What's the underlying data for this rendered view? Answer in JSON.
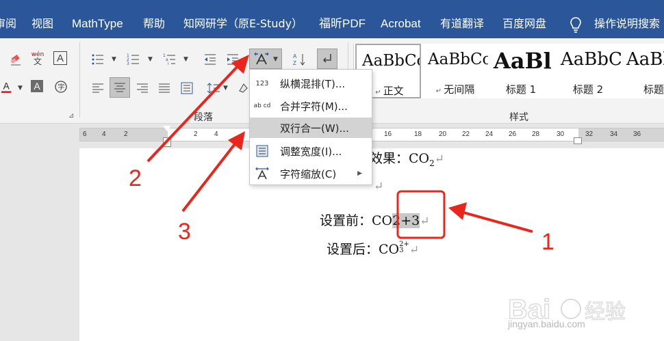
{
  "tabs": [
    "审阅",
    "视图",
    "MathType",
    "帮助",
    "知网研学（原E-Study）",
    "福昕PDF",
    "Acrobat",
    "有道翻译",
    "百度网盘",
    "操作说明搜索"
  ],
  "colors": {
    "tabbar": "#2b579a",
    "annotation_red": "#e8261c",
    "highlight_gray": "#c8c8c8",
    "menu_hover": "#d3d3d3"
  },
  "ribbon": {
    "group_paragraph_label": "段落",
    "group_styles_label": "样式",
    "icons": [
      "clear-format-icon",
      "phonetic-guide-icon",
      "character-border-icon",
      "font-color-icon",
      "character-shading-icon",
      "enclose-characters-icon",
      "bullets-icon",
      "numbering-icon",
      "multilevel-list-icon",
      "decrease-indent-icon",
      "increase-indent-icon",
      "asian-layout-icon",
      "sort-icon",
      "show-marks-icon",
      "align-left-icon",
      "align-center-icon",
      "align-right-icon",
      "justify-icon",
      "distributed-icon",
      "line-spacing-icon",
      "shading-icon",
      "borders-icon"
    ],
    "phonetic_top": "wén",
    "phonetic_bottom": "文",
    "styles": [
      {
        "sample": "AaBbCcDd",
        "name": "正文",
        "selected": true
      },
      {
        "sample": "AaBbCcDd",
        "name": "无间隔",
        "selected": false
      },
      {
        "sample": "AaBl",
        "name": "标题 1",
        "selected": false
      },
      {
        "sample": "AaBbC",
        "name": "标题 2",
        "selected": false
      },
      {
        "sample": "AaBb",
        "name": "标题",
        "selected": false
      }
    ]
  },
  "ruler": {
    "left_numbers": [
      "6",
      "4",
      "2",
      "2",
      "4"
    ],
    "right_numbers": [
      "16",
      "18",
      "20",
      "22",
      "24",
      "26",
      "28",
      "30",
      "32",
      "34",
      "36"
    ]
  },
  "menu": {
    "items": [
      {
        "icon_text": "123",
        "icon": "vertical-in-horizontal-icon",
        "label": "纵横混排(T)...",
        "hover": false,
        "submenu": false
      },
      {
        "icon_text": "ab cd",
        "icon": "combine-characters-icon",
        "label": "合并字符(M)...",
        "hover": false,
        "submenu": false
      },
      {
        "icon_text": "",
        "icon": "",
        "label": "双行合一(W)...",
        "hover": true,
        "submenu": false
      },
      {
        "icon_text": "",
        "icon": "fit-text-icon",
        "label": "调整宽度(I)...",
        "hover": false,
        "submenu": false
      },
      {
        "icon_text": "",
        "icon": "character-scaling-icon",
        "label": "字符缩放(C)",
        "hover": false,
        "submenu": true
      }
    ]
  },
  "document": {
    "line1": {
      "prefix": "效果：",
      "text": "CO",
      "sub": "2"
    },
    "line3": {
      "prefix": "设置前：",
      "before": "CO",
      "selected": "2+3"
    },
    "line4": {
      "prefix": "设置后：",
      "text": "CO",
      "top": "2+",
      "bottom": "3"
    }
  },
  "annotations": [
    "1",
    "2",
    "3"
  ],
  "watermark": {
    "url": "jingyan.baidu.com"
  }
}
